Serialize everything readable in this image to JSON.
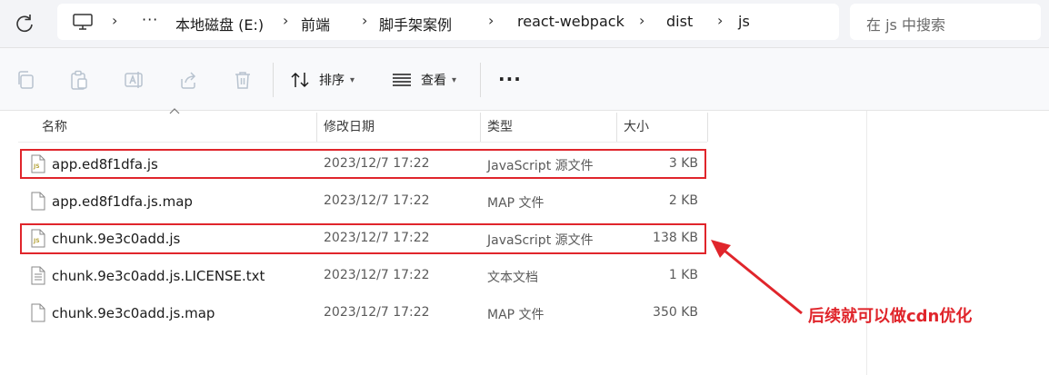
{
  "breadcrumb": {
    "overflow": "···",
    "items": [
      "本地磁盘 (E:)",
      "前端",
      "脚手架案例",
      "react-webpack",
      "dist",
      "js"
    ]
  },
  "search": {
    "placeholder": "在 js 中搜索"
  },
  "toolbar": {
    "sort_label": "排序",
    "view_label": "查看",
    "more_label": "···"
  },
  "columns": {
    "name": "名称",
    "date": "修改日期",
    "type": "类型",
    "size": "大小"
  },
  "files": [
    {
      "name": "app.ed8f1dfa.js",
      "date": "2023/12/7 17:22",
      "type": "JavaScript 源文件",
      "size": "3 KB",
      "icon": "js-file-icon"
    },
    {
      "name": "app.ed8f1dfa.js.map",
      "date": "2023/12/7 17:22",
      "type": "MAP 文件",
      "size": "2 KB",
      "icon": "blank-file-icon"
    },
    {
      "name": "chunk.9e3c0add.js",
      "date": "2023/12/7 17:22",
      "type": "JavaScript 源文件",
      "size": "138 KB",
      "icon": "js-file-icon"
    },
    {
      "name": "chunk.9e3c0add.js.LICENSE.txt",
      "date": "2023/12/7 17:22",
      "type": "文本文档",
      "size": "1 KB",
      "icon": "text-file-icon"
    },
    {
      "name": "chunk.9e3c0add.js.map",
      "date": "2023/12/7 17:22",
      "type": "MAP 文件",
      "size": "350 KB",
      "icon": "blank-file-icon"
    }
  ],
  "annotation": {
    "text": "后续就可以做cdn优化",
    "color": "#e0252b"
  },
  "colors": {
    "accent": "#e0252b",
    "js_icon": "#b5a33a"
  }
}
